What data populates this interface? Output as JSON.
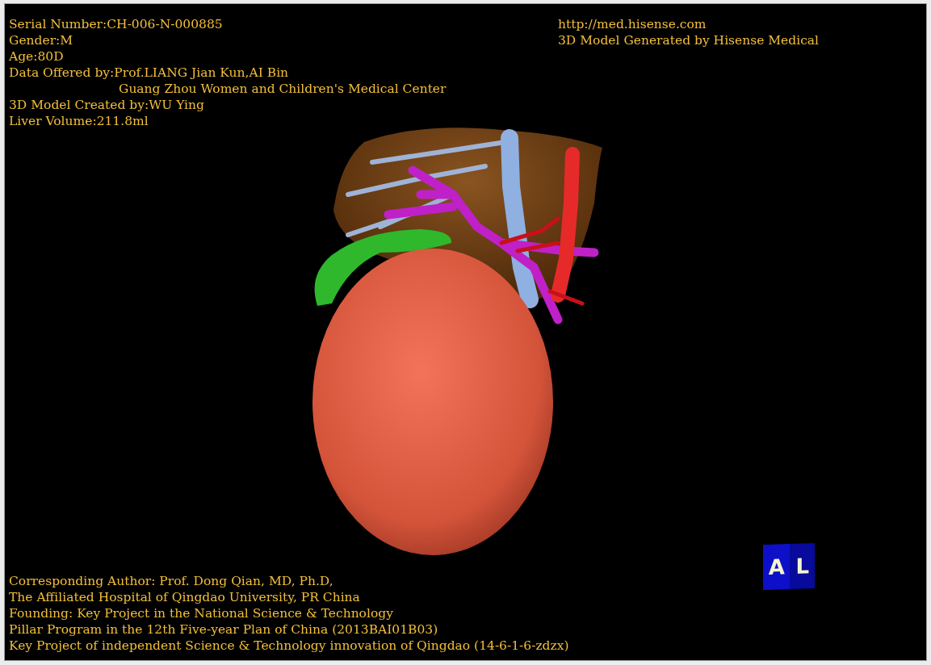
{
  "viewer": {
    "top_left_info": [
      {
        "kind": "line",
        "text": "Serial Number:CH-006-N-000885"
      },
      {
        "kind": "line",
        "text": "Gender:M"
      },
      {
        "kind": "line",
        "text": "Age:80D"
      },
      {
        "kind": "line",
        "text": "Data Offered by:Prof.LIANG Jian Kun,AI Bin"
      },
      {
        "kind": "indented",
        "text": "Guang Zhou Women and Children's Medical Center"
      },
      {
        "kind": "line",
        "text": "3D Model Created by:WU Ying"
      },
      {
        "kind": "line",
        "text": "Liver Volume:211.8ml"
      }
    ],
    "top_right_info": [
      {
        "kind": "line",
        "text": "http://med.hisense.com"
      },
      {
        "kind": "line",
        "text": "3D Model Generated by Hisense Medical"
      }
    ],
    "bottom_info": [
      {
        "kind": "line",
        "text": "Corresponding Author: Prof. Dong Qian, MD, Ph.D,"
      },
      {
        "kind": "line",
        "text": "The Affiliated Hospital of Qingdao University, PR China"
      },
      {
        "kind": "line",
        "text": "Founding: Key Project in the National Science & Technology"
      },
      {
        "kind": "line",
        "text": "Pillar Program in the 12th Five-year Plan of China (2013BAI01B03)"
      },
      {
        "kind": "line",
        "text": "Key Project of independent Science & Technology innovation of Qingdao (14-6-1-6-zdzx)"
      }
    ],
    "orientation_cube": {
      "labels": [
        "A",
        "L"
      ]
    }
  }
}
